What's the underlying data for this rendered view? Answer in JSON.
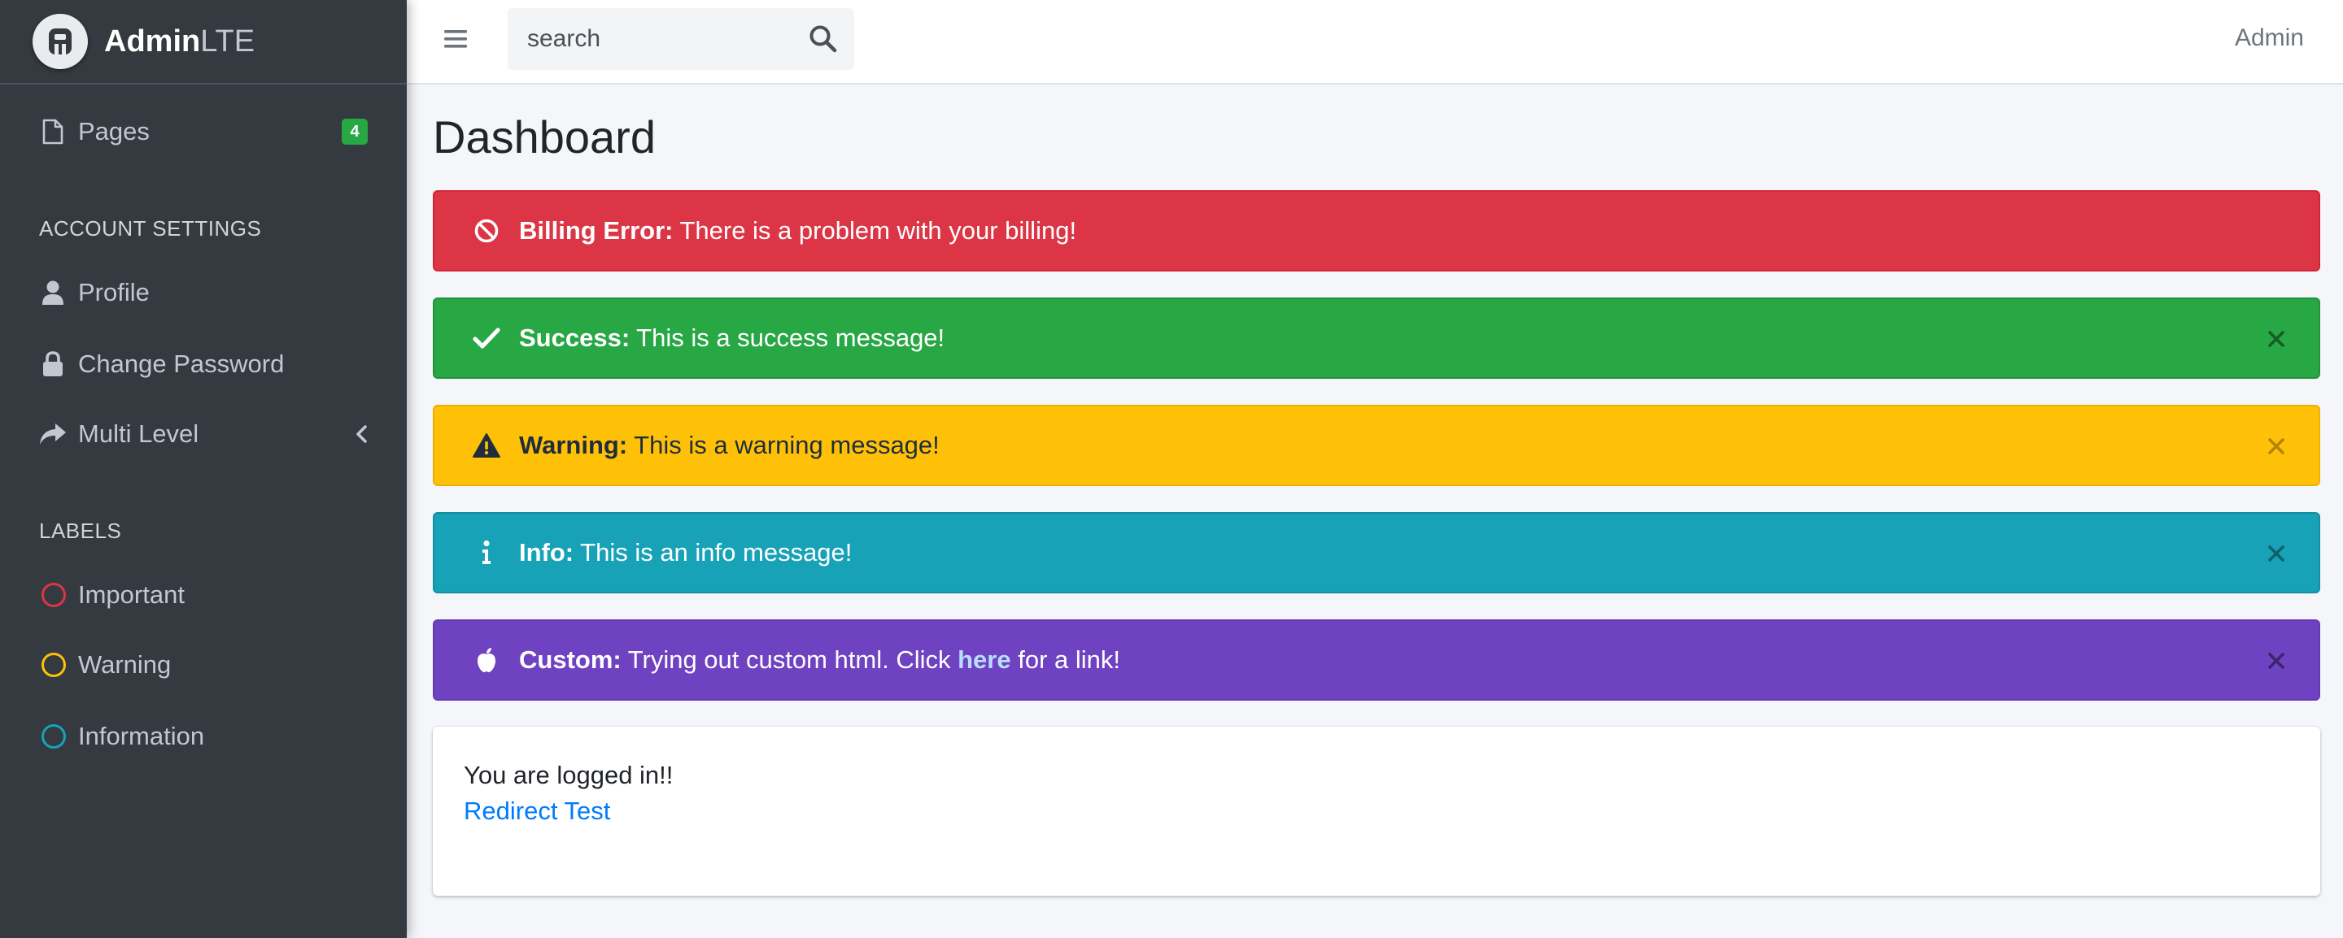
{
  "brand": {
    "name_bold": "Admin",
    "name_light": "LTE",
    "logo_icon": "adminlte-logo"
  },
  "sidebar": {
    "pages": {
      "label": "Pages",
      "badge": "4",
      "icon": "file-icon",
      "badge_color": "#28a745"
    },
    "account_header": "ACCOUNT SETTINGS",
    "account_items": [
      {
        "label": "Profile",
        "icon": "user-icon"
      },
      {
        "label": "Change Password",
        "icon": "lock-icon"
      },
      {
        "label": "Multi Level",
        "icon": "share-icon"
      }
    ],
    "labels_header": "LABELS",
    "labels": [
      {
        "label": "Important",
        "color": "#dc3545"
      },
      {
        "label": "Warning",
        "color": "#ffc107"
      },
      {
        "label": "Information",
        "color": "#17a2b8"
      }
    ]
  },
  "topbar": {
    "search_placeholder": "search",
    "user": "Admin"
  },
  "content": {
    "title": "Dashboard",
    "alerts": [
      {
        "type": "danger",
        "icon": "ban-icon",
        "title": "Billing Error:",
        "message": "There is a problem with your billing!",
        "color": "#dc3545"
      },
      {
        "type": "success",
        "icon": "check-icon",
        "title": "Success:",
        "message": "This is a success message!",
        "color": "#28a745"
      },
      {
        "type": "warning",
        "icon": "warning-icon",
        "title": "Warning:",
        "message": "This is a warning message!",
        "color": "#ffc107"
      },
      {
        "type": "info",
        "icon": "info-icon",
        "title": "Info:",
        "message": "This is an info message!",
        "color": "#17a2b8"
      },
      {
        "type": "custom",
        "icon": "apple-icon",
        "title": "Custom:",
        "message_before": "Trying out custom html. Click",
        "link": "here",
        "message_after": "for a link!",
        "color": "#6f42c1"
      }
    ],
    "card": {
      "text": "You are logged in!!",
      "link": "Redirect Test"
    }
  }
}
